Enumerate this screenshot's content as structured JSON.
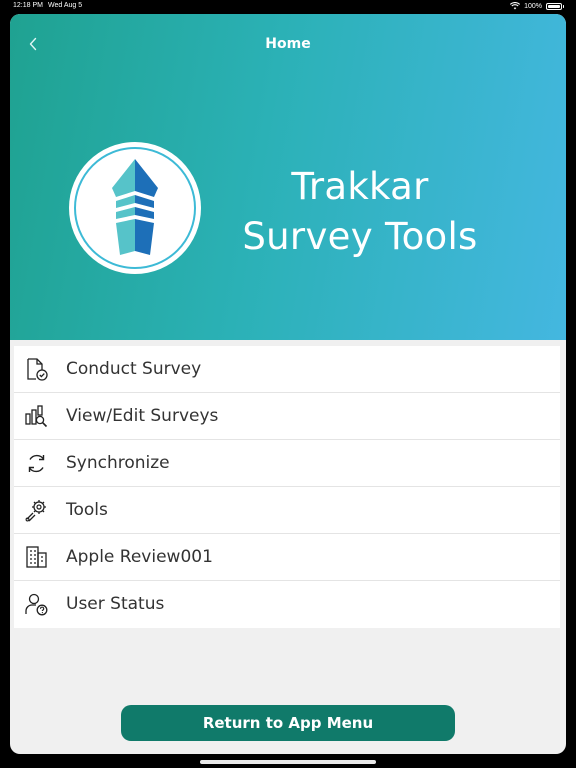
{
  "status_bar": {
    "time": "12:18 PM",
    "date": "Wed Aug 5",
    "battery": "100%"
  },
  "nav": {
    "title": "Home",
    "back_icon": "chevron-left-icon"
  },
  "brand": {
    "line1": "Trakkar",
    "line2": "Survey Tools"
  },
  "colors": {
    "accent": "#107a6a",
    "hero_start": "#1fa291",
    "hero_end": "#44b7e0"
  },
  "menu": {
    "items": [
      {
        "label": "Conduct Survey",
        "icon": "document-check-icon"
      },
      {
        "label": "View/Edit Surveys",
        "icon": "chart-search-icon"
      },
      {
        "label": "Synchronize",
        "icon": "sync-icon"
      },
      {
        "label": "Tools",
        "icon": "gear-wrench-icon"
      },
      {
        "label": "Apple Review001",
        "icon": "building-icon"
      },
      {
        "label": "User Status",
        "icon": "user-question-icon"
      }
    ]
  },
  "footer": {
    "return_label": "Return to App Menu"
  }
}
